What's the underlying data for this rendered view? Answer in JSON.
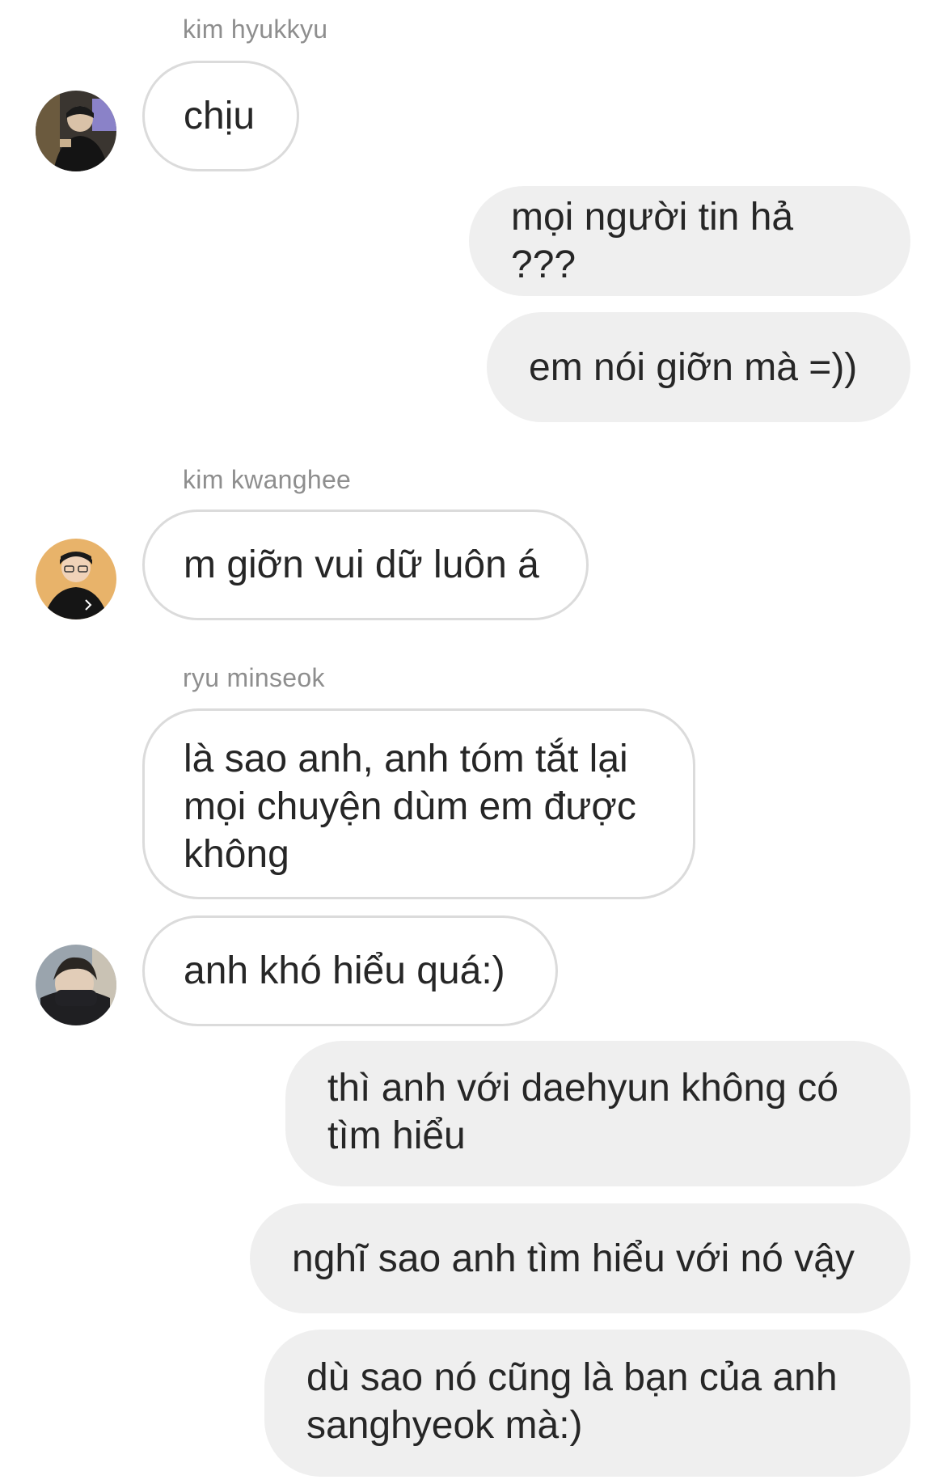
{
  "conversation": {
    "messages": [
      {
        "sender_label": "kim hyukkyu",
        "text": "chịu",
        "direction": "incoming",
        "avatar": "avatar-kim-hyukkyu"
      },
      {
        "text": "mọi người tin hả ???",
        "direction": "outgoing"
      },
      {
        "text": "em nói giỡn mà =))",
        "direction": "outgoing"
      },
      {
        "sender_label": "kim kwanghee",
        "text": "m giỡn vui dữ luôn á",
        "direction": "incoming",
        "avatar": "avatar-kim-kwanghee"
      },
      {
        "sender_label": "ryu minseok",
        "text": "là sao anh, anh tóm tắt lại mọi chuyện dùm em được không",
        "direction": "incoming"
      },
      {
        "text": "anh khó hiểu quá:)",
        "direction": "incoming",
        "avatar": "avatar-ryu-minseok"
      },
      {
        "text": "thì anh với daehyun không có tìm hiểu",
        "direction": "outgoing"
      },
      {
        "text": "nghĩ sao anh tìm hiểu với nó vậy",
        "direction": "outgoing"
      },
      {
        "text": "dù sao nó cũng là bạn của anh sanghyeok mà:)",
        "direction": "outgoing"
      }
    ]
  },
  "colors": {
    "incoming_bubble_bg": "#ffffff",
    "incoming_bubble_border": "#dbdbdb",
    "outgoing_bubble_bg": "#efefef",
    "text": "#262626",
    "sender_label": "#8e8e8e"
  }
}
